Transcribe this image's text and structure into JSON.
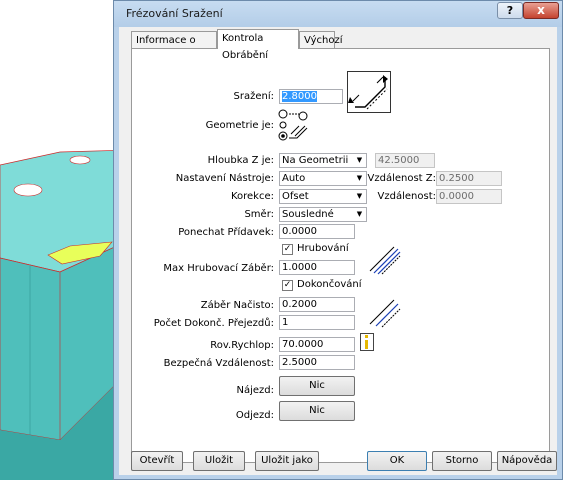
{
  "window": {
    "title": "Frézování Sražení",
    "help_icon": "?",
    "close_icon": "x"
  },
  "tabs": [
    {
      "label": "Informace o Nástroji"
    },
    {
      "label": "Kontrola Obrábění",
      "active": true
    },
    {
      "label": "Výchozí"
    }
  ],
  "form": {
    "srazeni": {
      "label": "Sražení:",
      "value": "2.8000"
    },
    "geometrie": {
      "label": "Geometrie je:"
    },
    "hloubka": {
      "label": "Hloubka Z je:",
      "value": "Na Geometrii",
      "extra": "42.5000"
    },
    "nastaveni": {
      "label": "Nastavení Nástroje:",
      "value": "Auto"
    },
    "vzdalenost_z": {
      "label": "Vzdálenost Z:",
      "value": "0.2500"
    },
    "korekce": {
      "label": "Korekce:",
      "value": "Ofset"
    },
    "vzdalenost": {
      "label": "Vzdálenost:",
      "value": "0.0000"
    },
    "smer": {
      "label": "Směr:",
      "value": "Sousledné"
    },
    "ponechat": {
      "label": "Ponechat Přídavek:",
      "value": "0.0000"
    },
    "hrubovani": {
      "label": "Hrubování",
      "checked": true
    },
    "max_hrub": {
      "label": "Max Hrubovací Záběr:",
      "value": "1.0000"
    },
    "dokoncovani": {
      "label": "Dokončování",
      "checked": true
    },
    "zaber": {
      "label": "Záběr Načisto:",
      "value": "0.2000"
    },
    "pocet": {
      "label": "Počet Dokonč. Přejezdů:",
      "value": "1"
    },
    "rov_rychlop": {
      "label": "Rov.Rychlop:",
      "value": "70.0000"
    },
    "bezpecna": {
      "label": "Bezpečná Vzdálenost:",
      "value": "2.5000"
    },
    "najezd": {
      "label": "Nájezd:",
      "button": "Nic"
    },
    "odjezd": {
      "label": "Odjezd:",
      "button": "Nic"
    }
  },
  "footer": {
    "otevrit": "Otevřít",
    "ulozit": "Uložit",
    "ulozit_jako": "Uložit jako",
    "ok": "OK",
    "storno": "Storno",
    "napoveda": "Nápověda"
  },
  "colors": {
    "part_face": "#58c8c4",
    "part_edge": "#cc2a2a",
    "selection": "#3399ff",
    "title_bar": "#b9d1ea"
  }
}
